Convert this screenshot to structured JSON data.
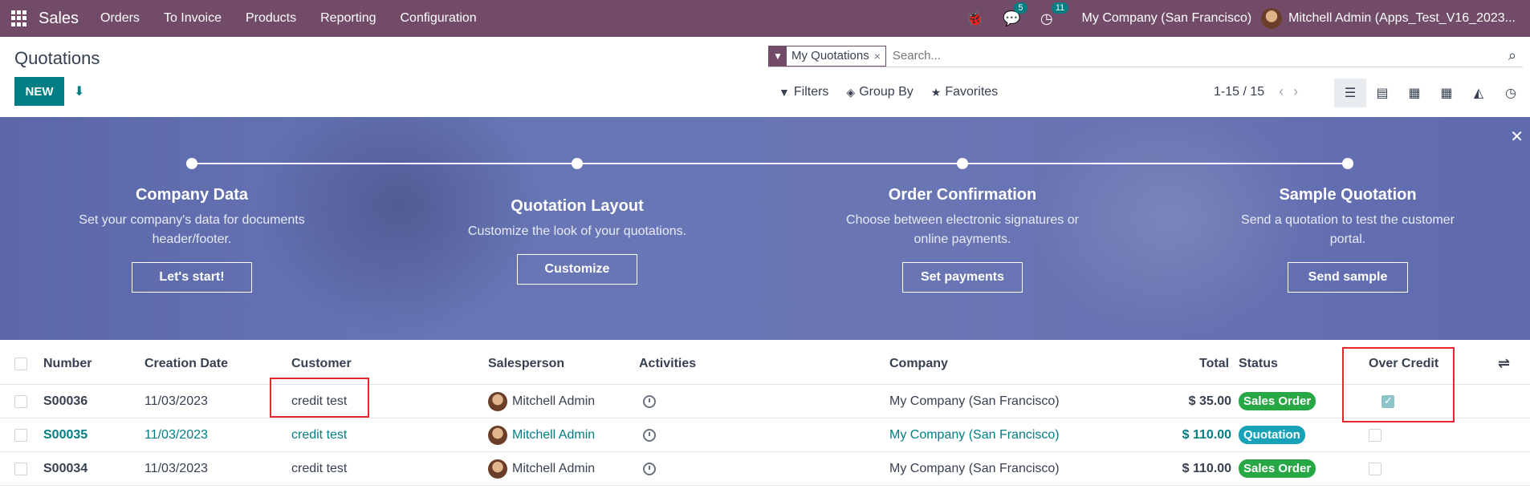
{
  "navbar": {
    "app_name": "Sales",
    "menu": [
      "Orders",
      "To Invoice",
      "Products",
      "Reporting",
      "Configuration"
    ],
    "messages_count": "5",
    "activities_count": "11",
    "company": "My Company (San Francisco)",
    "user": "Mitchell Admin (Apps_Test_V16_2023..."
  },
  "page": {
    "title": "Quotations",
    "new_label": "NEW"
  },
  "search": {
    "facet_label": "My Quotations",
    "placeholder": "Search...",
    "filters_label": "Filters",
    "groupby_label": "Group By",
    "favorites_label": "Favorites"
  },
  "pager": {
    "value": "1-15 / 15"
  },
  "banner": {
    "steps": [
      {
        "title": "Company Data",
        "desc": "Set your company's data for documents header/footer.",
        "button": "Let's start!"
      },
      {
        "title": "Quotation Layout",
        "desc": "Customize the look of your quotations.",
        "button": "Customize"
      },
      {
        "title": "Order Confirmation",
        "desc": "Choose between electronic signatures or online payments.",
        "button": "Set payments"
      },
      {
        "title": "Sample Quotation",
        "desc": "Send a quotation to test the customer portal.",
        "button": "Send sample"
      }
    ]
  },
  "table": {
    "headers": [
      "Number",
      "Creation Date",
      "Customer",
      "Salesperson",
      "Activities",
      "Company",
      "Total",
      "Status",
      "Over Credit"
    ],
    "rows": [
      {
        "number": "S00036",
        "date": "11/03/2023",
        "customer": "credit test",
        "salesperson": "Mitchell Admin",
        "company": "My Company (San Francisco)",
        "total": "$ 35.00",
        "status": "Sales Order",
        "over_credit": true
      },
      {
        "number": "S00035",
        "date": "11/03/2023",
        "customer": "credit test",
        "salesperson": "Mitchell Admin",
        "company": "My Company (San Francisco)",
        "total": "$ 110.00",
        "status": "Quotation",
        "over_credit": false
      },
      {
        "number": "S00034",
        "date": "11/03/2023",
        "customer": "credit test",
        "salesperson": "Mitchell Admin",
        "company": "My Company (San Francisco)",
        "total": "$ 110.00",
        "status": "Sales Order",
        "over_credit": false
      }
    ]
  },
  "colors": {
    "brand": "#714b67",
    "accent": "#017e84",
    "highlight_box": "#e5262c"
  }
}
